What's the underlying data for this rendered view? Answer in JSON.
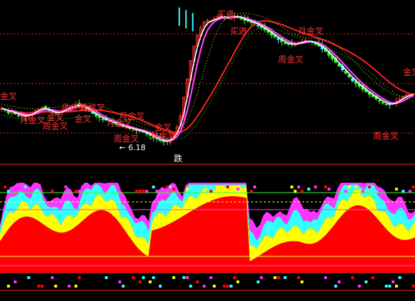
{
  "chart_data": {
    "type": "candlestick",
    "annotations": [
      {
        "id": "a1",
        "text": "金叉",
        "kind": "signal"
      },
      {
        "id": "a2",
        "text": "月金叉",
        "kind": "signal"
      },
      {
        "id": "a3",
        "text": "周金叉",
        "kind": "signal"
      },
      {
        "id": "a4",
        "text": "金叉",
        "kind": "signal"
      },
      {
        "id": "a5",
        "text": "月金叉",
        "kind": "signal"
      },
      {
        "id": "a6",
        "text": "周金叉",
        "kind": "signal"
      },
      {
        "id": "a7",
        "text": "金叉",
        "kind": "signal"
      },
      {
        "id": "a8",
        "text": "月金叉",
        "kind": "signal"
      },
      {
        "id": "a9",
        "text": "月金叉",
        "kind": "signal"
      },
      {
        "id": "a10",
        "text": "周金叉",
        "kind": "signal"
      },
      {
        "id": "a11",
        "text": "金叉",
        "kind": "signal"
      },
      {
        "id": "a12",
        "text": "月金叉",
        "kind": "signal"
      },
      {
        "id": "a13",
        "text": "买进",
        "kind": "buy"
      },
      {
        "id": "a14",
        "text": "买进",
        "kind": "buy"
      },
      {
        "id": "a15",
        "text": "月金叉",
        "kind": "signal"
      },
      {
        "id": "a16",
        "text": "周金叉",
        "kind": "signal"
      },
      {
        "id": "a17",
        "text": "金叉",
        "kind": "signal"
      },
      {
        "id": "a18",
        "text": "周金叉",
        "kind": "signal"
      }
    ],
    "low_marker": "← 6.18",
    "divider_label": "跌",
    "colors": {
      "candle_up": "#ff3030",
      "candle_down": "#33ff33",
      "candle_cyan": "#33ffff",
      "ma_white": "#ffffff",
      "ma_magenta": "#ff40ff",
      "ma_red": "#ff2020",
      "ma_yellow": "#ffff40",
      "ma_green": "#33ff33",
      "area_red": "#ff0000",
      "area_yellow": "#ffff00",
      "area_cyan": "#33ffff",
      "area_magenta": "#ff33ff",
      "hline_red": "#ff2020",
      "hline_green": "#33ff33",
      "hline_yellow": "#ffff40",
      "hline_magenta": "#ff40ff"
    },
    "closes": [
      7.1,
      7.05,
      6.98,
      7.02,
      6.95,
      6.9,
      6.92,
      6.88,
      6.93,
      6.99,
      7.04,
      7.08,
      7.12,
      7.09,
      7.03,
      6.98,
      6.97,
      7.0,
      7.05,
      7.1,
      7.13,
      7.16,
      7.2,
      7.18,
      7.14,
      7.08,
      7.02,
      6.96,
      6.9,
      6.85,
      6.8,
      6.78,
      6.74,
      6.7,
      6.66,
      6.63,
      6.6,
      6.58,
      6.55,
      6.52,
      6.5,
      6.48,
      6.45,
      6.4,
      6.36,
      6.3,
      6.26,
      6.22,
      6.19,
      6.2,
      6.28,
      6.4,
      6.6,
      6.9,
      7.4,
      7.9,
      8.4,
      8.8,
      9.1,
      9.3,
      9.45,
      9.5,
      9.48,
      9.55,
      9.6,
      9.62,
      9.58,
      9.55,
      9.6,
      9.63,
      9.58,
      9.55,
      9.5,
      9.48,
      9.45,
      9.4,
      9.36,
      9.3,
      9.24,
      9.18,
      9.1,
      9.05,
      8.98,
      8.92,
      8.88,
      8.85,
      8.84,
      8.86,
      8.9,
      8.92,
      8.95,
      8.93,
      8.9,
      8.85,
      8.8,
      8.72,
      8.65,
      8.55,
      8.45,
      8.35,
      8.25,
      8.15,
      8.05,
      7.95,
      7.85,
      7.78,
      7.7,
      7.62,
      7.55,
      7.48,
      7.42,
      7.36,
      7.3,
      7.26,
      7.22,
      7.2,
      7.24,
      7.3,
      7.36,
      7.42,
      7.46,
      7.48,
      7.5
    ]
  }
}
